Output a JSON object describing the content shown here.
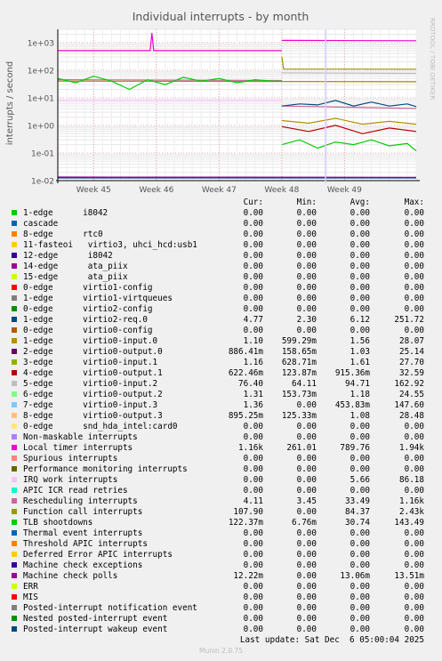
{
  "chart_data": {
    "type": "line",
    "title": "Individual interrupts - by month",
    "ylabel": "interrupts / second",
    "watermark": "RRDTOOL / TOBI OETIKER",
    "yscale": "log",
    "ylim": [
      0.01,
      3000
    ],
    "yticks": [
      {
        "v": 0.01,
        "label": "1e-02"
      },
      {
        "v": 0.1,
        "label": "1e-01"
      },
      {
        "v": 1,
        "label": "1e+00"
      },
      {
        "v": 10,
        "label": "1e+01"
      },
      {
        "v": 100,
        "label": "1e+02"
      },
      {
        "v": 1000,
        "label": "1e+03"
      }
    ],
    "xlim": [
      0,
      40
    ],
    "xticks": [
      {
        "v": 4,
        "label": "Week 45"
      },
      {
        "v": 11,
        "label": "Week 46"
      },
      {
        "v": 18,
        "label": "Week 47"
      },
      {
        "v": 25,
        "label": "Week 48"
      },
      {
        "v": 32,
        "label": "Week 49"
      }
    ],
    "columns": [
      "Cur:",
      "Min:",
      "Avg:",
      "Max:"
    ],
    "series": [
      {
        "name": "1-edge      i8042",
        "color": "#00cc00",
        "cur": "0.00",
        "min": "0.00",
        "avg": "0.00",
        "max": "0.00"
      },
      {
        "name": "cascade",
        "color": "#0066b3",
        "cur": "0.00",
        "min": "0.00",
        "avg": "0.00",
        "max": "0.00"
      },
      {
        "name": "8-edge      rtc0",
        "color": "#ff8000",
        "cur": "0.00",
        "min": "0.00",
        "avg": "0.00",
        "max": "0.00"
      },
      {
        "name": "11-fasteoi   virtio3, uhci_hcd:usb1",
        "color": "#ffcc00",
        "cur": "0.00",
        "min": "0.00",
        "avg": "0.00",
        "max": "0.00"
      },
      {
        "name": "12-edge      i8042",
        "color": "#330099",
        "cur": "0.00",
        "min": "0.00",
        "avg": "0.00",
        "max": "0.00"
      },
      {
        "name": "14-edge      ata_piix",
        "color": "#990099",
        "cur": "0.00",
        "min": "0.00",
        "avg": "0.00",
        "max": "0.00"
      },
      {
        "name": "15-edge      ata_piix",
        "color": "#ccff00",
        "cur": "0.00",
        "min": "0.00",
        "avg": "0.00",
        "max": "0.00"
      },
      {
        "name": "0-edge      virtio1-config",
        "color": "#ff0000",
        "cur": "0.00",
        "min": "0.00",
        "avg": "0.00",
        "max": "0.00"
      },
      {
        "name": "1-edge      virtio1-virtqueues",
        "color": "#808080",
        "cur": "0.00",
        "min": "0.00",
        "avg": "0.00",
        "max": "0.00"
      },
      {
        "name": "0-edge      virtio2-config",
        "color": "#008f00",
        "cur": "0.00",
        "min": "0.00",
        "avg": "0.00",
        "max": "0.00"
      },
      {
        "name": "1-edge      virtio2-req.0",
        "color": "#00487d",
        "cur": "4.77",
        "min": "2.30",
        "avg": "6.12",
        "max": "251.72"
      },
      {
        "name": "0-edge      virtio0-config",
        "color": "#b35a00",
        "cur": "0.00",
        "min": "0.00",
        "avg": "0.00",
        "max": "0.00"
      },
      {
        "name": "1-edge      virtio0-input.0",
        "color": "#b38f00",
        "cur": "1.10",
        "min": "599.29m",
        "avg": "1.56",
        "max": "28.07"
      },
      {
        "name": "2-edge      virtio0-output.0",
        "color": "#6b006b",
        "cur": "886.41m",
        "min": "158.65m",
        "avg": "1.03",
        "max": "25.14"
      },
      {
        "name": "3-edge      virtio0-input.1",
        "color": "#8fb300",
        "cur": "1.16",
        "min": "628.71m",
        "avg": "1.61",
        "max": "27.70"
      },
      {
        "name": "4-edge      virtio0-output.1",
        "color": "#b30000",
        "cur": "622.46m",
        "min": "123.87m",
        "avg": "915.36m",
        "max": "32.59"
      },
      {
        "name": "5-edge      virtio0-input.2",
        "color": "#bebebe",
        "cur": "76.40",
        "min": "64.11",
        "avg": "94.71",
        "max": "162.92"
      },
      {
        "name": "6-edge      virtio0-output.2",
        "color": "#80ff80",
        "cur": "1.31",
        "min": "153.73m",
        "avg": "1.18",
        "max": "24.55"
      },
      {
        "name": "7-edge      virtio0-input.3",
        "color": "#80c9ff",
        "cur": "1.36",
        "min": "0.00",
        "avg": "453.83m",
        "max": "147.60"
      },
      {
        "name": "8-edge      virtio0-output.3",
        "color": "#ffc080",
        "cur": "895.25m",
        "min": "125.33m",
        "avg": "1.08",
        "max": "28.48"
      },
      {
        "name": "0-edge      snd_hda_intel:card0",
        "color": "#ffe680",
        "cur": "0.00",
        "min": "0.00",
        "avg": "0.00",
        "max": "0.00"
      },
      {
        "name": "Non-maskable interrupts",
        "color": "#aa80ff",
        "cur": "0.00",
        "min": "0.00",
        "avg": "0.00",
        "max": "0.00"
      },
      {
        "name": "Local timer interrupts",
        "color": "#ee00cc",
        "cur": "1.16k",
        "min": "261.01",
        "avg": "789.76",
        "max": "1.94k"
      },
      {
        "name": "Spurious interrupts",
        "color": "#ff8080",
        "cur": "0.00",
        "min": "0.00",
        "avg": "0.00",
        "max": "0.00"
      },
      {
        "name": "Performance monitoring interrupts",
        "color": "#666600",
        "cur": "0.00",
        "min": "0.00",
        "avg": "0.00",
        "max": "0.00"
      },
      {
        "name": "IRQ work interrupts",
        "color": "#ffbfff",
        "cur": "0.00",
        "min": "0.00",
        "avg": "5.66",
        "max": "86.18"
      },
      {
        "name": "APIC ICR read retries",
        "color": "#00ffcc",
        "cur": "0.00",
        "min": "0.00",
        "avg": "0.00",
        "max": "0.00"
      },
      {
        "name": "Rescheduling interrupts",
        "color": "#cc6699",
        "cur": "4.11",
        "min": "3.45",
        "avg": "33.49",
        "max": "1.16k"
      },
      {
        "name": "Function call interrupts",
        "color": "#999900",
        "cur": "107.90",
        "min": "0.00",
        "avg": "84.37",
        "max": "2.43k"
      },
      {
        "name": "TLB shootdowns",
        "color": "#00cc00",
        "cur": "122.37m",
        "min": "6.76m",
        "avg": "30.74",
        "max": "143.49"
      },
      {
        "name": "Thermal event interrupts",
        "color": "#0066b3",
        "cur": "0.00",
        "min": "0.00",
        "avg": "0.00",
        "max": "0.00"
      },
      {
        "name": "Threshold APIC interrupts",
        "color": "#ff8000",
        "cur": "0.00",
        "min": "0.00",
        "avg": "0.00",
        "max": "0.00"
      },
      {
        "name": "Deferred Error APIC interrupts",
        "color": "#ffcc00",
        "cur": "0.00",
        "min": "0.00",
        "avg": "0.00",
        "max": "0.00"
      },
      {
        "name": "Machine check exceptions",
        "color": "#330099",
        "cur": "0.00",
        "min": "0.00",
        "avg": "0.00",
        "max": "0.00"
      },
      {
        "name": "Machine check polls",
        "color": "#990099",
        "cur": "12.22m",
        "min": "0.00",
        "avg": "13.06m",
        "max": "13.51m"
      },
      {
        "name": "ERR",
        "color": "#ccff00",
        "cur": "0.00",
        "min": "0.00",
        "avg": "0.00",
        "max": "0.00"
      },
      {
        "name": "MIS",
        "color": "#ff0000",
        "cur": "0.00",
        "min": "0.00",
        "avg": "0.00",
        "max": "0.00"
      },
      {
        "name": "Posted-interrupt notification event",
        "color": "#808080",
        "cur": "0.00",
        "min": "0.00",
        "avg": "0.00",
        "max": "0.00"
      },
      {
        "name": "Nested posted-interrupt event",
        "color": "#008f00",
        "cur": "0.00",
        "min": "0.00",
        "avg": "0.00",
        "max": "0.00"
      },
      {
        "name": "Posted-interrupt wakeup event",
        "color": "#00487d",
        "cur": "0.00",
        "min": "0.00",
        "avg": "0.00",
        "max": "0.00"
      }
    ],
    "lines": [
      {
        "series": "Local timer interrupts",
        "color": "#ee00cc",
        "segments": [
          {
            "x": [
              0,
              10.3,
              10.5,
              10.7,
              25
            ],
            "y": [
              510,
              510,
              2200,
              510,
              510
            ]
          },
          {
            "x": [
              25,
              25.2,
              40
            ],
            "y": [
              1200,
              1200,
              1160
            ]
          }
        ]
      },
      {
        "series": "Function call interrupts",
        "color": "#999900",
        "segments": [
          {
            "x": [
              0,
              40
            ],
            "y": [
              40,
              38
            ]
          },
          {
            "x": [
              25,
              25.2,
              40
            ],
            "y": [
              300,
              110,
              108
            ]
          }
        ]
      },
      {
        "series": "Rescheduling interrupts",
        "color": "#cc6699",
        "segments": [
          {
            "x": [
              0,
              25
            ],
            "y": [
              45,
              42
            ]
          },
          {
            "x": [
              25,
              40
            ],
            "y": [
              5,
              4.1
            ]
          }
        ]
      },
      {
        "series": "TLB shootdowns",
        "color": "#00cc00",
        "segments": [
          {
            "x": [
              0,
              2,
              4,
              6,
              8,
              10,
              12,
              14,
              16,
              18,
              20,
              22,
              24,
              25
            ],
            "y": [
              50,
              35,
              60,
              40,
              20,
              45,
              30,
              55,
              40,
              50,
              35,
              45,
              40,
              40
            ]
          },
          {
            "x": [
              25,
              27,
              29,
              31,
              33,
              35,
              37,
              39,
              40
            ],
            "y": [
              0.2,
              0.3,
              0.15,
              0.25,
              0.2,
              0.3,
              0.18,
              0.22,
              0.12
            ]
          }
        ]
      },
      {
        "series": "IRQ work interrupts",
        "color": "#ffbfff",
        "segments": [
          {
            "x": [
              0,
              25
            ],
            "y": [
              8,
              8
            ]
          }
        ]
      },
      {
        "series": "virtio0-input.2",
        "color": "#bebebe",
        "segments": [
          {
            "x": [
              25,
              40
            ],
            "y": [
              80,
              76
            ]
          }
        ]
      },
      {
        "series": "virtio2-req.0",
        "color": "#00487d",
        "segments": [
          {
            "x": [
              25,
              27,
              29,
              31,
              33,
              35,
              37,
              39,
              40
            ],
            "y": [
              5,
              6,
              5.5,
              8,
              5,
              7,
              5,
              6,
              4.8
            ]
          }
        ]
      },
      {
        "series": "virtio0-input.0",
        "color": "#b38f00",
        "segments": [
          {
            "x": [
              25,
              28,
              31,
              34,
              37,
              40
            ],
            "y": [
              1.5,
              1.2,
              1.8,
              1.1,
              1.4,
              1.1
            ]
          }
        ]
      },
      {
        "series": "virtio0-output.1",
        "color": "#b30000",
        "segments": [
          {
            "x": [
              25,
              28,
              31,
              34,
              37,
              40
            ],
            "y": [
              0.9,
              0.6,
              1.0,
              0.5,
              0.8,
              0.6
            ]
          }
        ]
      },
      {
        "series": "Machine check polls",
        "color": "#990099",
        "segments": [
          {
            "x": [
              0,
              40
            ],
            "y": [
              0.0135,
              0.0132
            ]
          }
        ]
      },
      {
        "series": "Posted-interrupt wakeup event",
        "color": "#00487d",
        "segments": [
          {
            "x": [
              0,
              40
            ],
            "y": [
              0.0125,
              0.0125
            ]
          }
        ]
      }
    ]
  },
  "footer": {
    "last_update": "Last update: Sat Dec  6 05:00:04 2025",
    "munin": "Munin 2.0.75"
  }
}
